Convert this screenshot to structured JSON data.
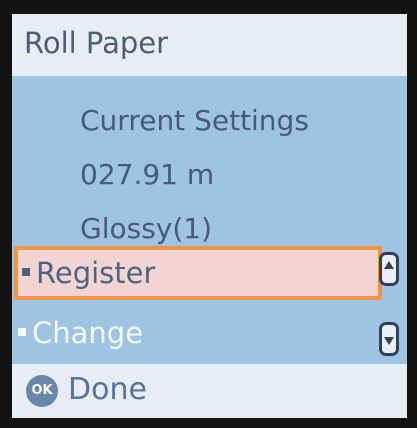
{
  "screen": {
    "title": "Roll Paper",
    "info": {
      "heading": "Current Settings",
      "length": "027.91 m",
      "media": "Glossy(1)"
    },
    "menu": {
      "selected": "Register",
      "next": "Change"
    },
    "footer": {
      "ok_label": "OK",
      "done_label": "Done"
    }
  }
}
